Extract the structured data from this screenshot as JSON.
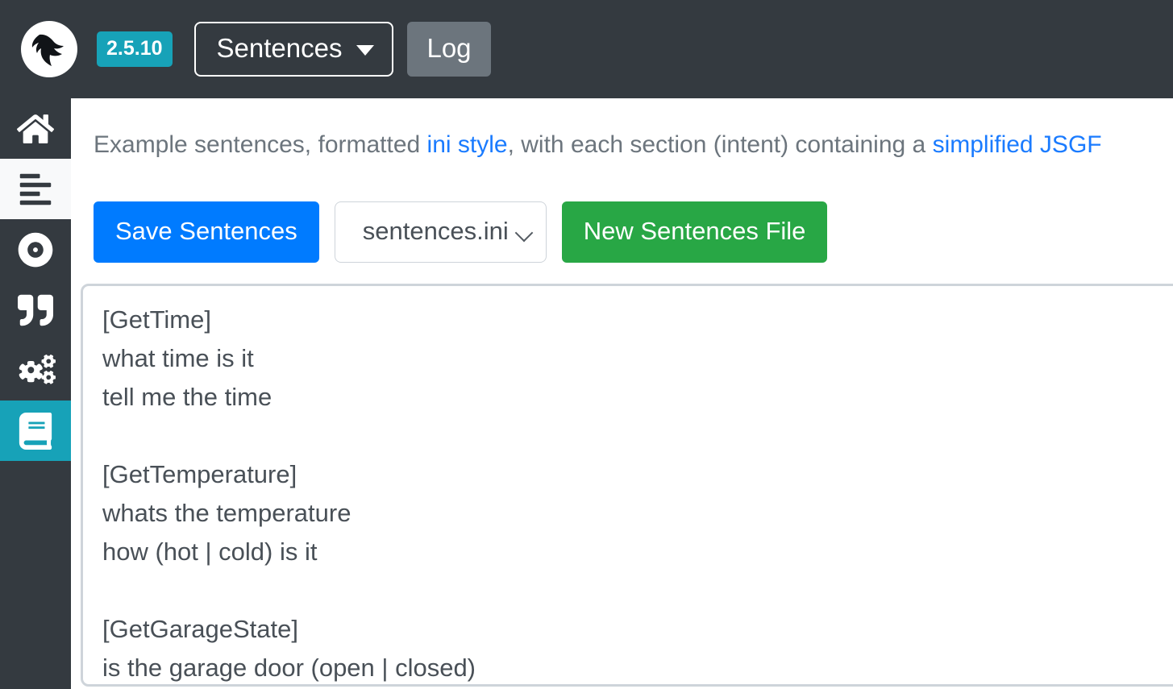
{
  "header": {
    "logo_icon": "rhasspy-bird-logo",
    "version": "2.5.10",
    "page_dropdown": {
      "label": "Sentences",
      "caret_icon": "caret-down-icon"
    },
    "log_button": "Log"
  },
  "sidebar": {
    "items": [
      {
        "icon": "home-icon",
        "name": "sidebar-item-home",
        "state": "default"
      },
      {
        "icon": "align-left-icon",
        "name": "sidebar-item-words",
        "state": "light"
      },
      {
        "icon": "compact-disc-icon",
        "name": "sidebar-item-speech",
        "state": "default"
      },
      {
        "icon": "quote-right-icon",
        "name": "sidebar-item-wake",
        "state": "default"
      },
      {
        "icon": "cogs-icon",
        "name": "sidebar-item-settings",
        "state": "default"
      },
      {
        "icon": "book-icon",
        "name": "sidebar-item-sentences",
        "state": "active"
      }
    ]
  },
  "main": {
    "description": {
      "part1": "Example sentences, formatted ",
      "link1": "ini style",
      "part2": ", with each section (intent) containing a ",
      "link2": "simplified JSGF"
    },
    "toolbar": {
      "save_label": "Save Sentences",
      "file_select_value": "sentences.ini",
      "file_select_chevron": "chevron-down-icon",
      "new_file_label": "New Sentences File"
    },
    "editor": {
      "value": "[GetTime]\nwhat time is it\ntell me the time\n\n[GetTemperature]\nwhats the temperature\nhow (hot | cold) is it\n\n[GetGarageState]\nis the garage door (open | closed)"
    }
  },
  "colors": {
    "navbar_bg": "#343a40",
    "accent_teal": "#17a2b8",
    "primary_blue": "#007bff",
    "success_green": "#28a745",
    "secondary_grey": "#6c757d",
    "link_blue": "#1a7bff",
    "muted_text": "#6c757d",
    "editor_text": "#495057",
    "border_grey": "#ced4da"
  }
}
